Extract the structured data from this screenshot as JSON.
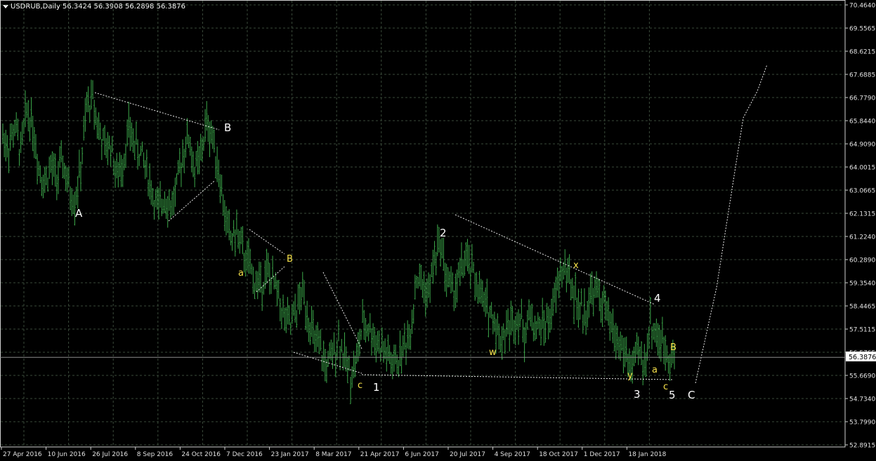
{
  "window": {
    "symbol_header": "USDRUB,Daily",
    "ohlc_header": "56.3424 56.3908 56.2898 56.3876",
    "current_price_label": "56.3876"
  },
  "colors": {
    "background": "#000000",
    "grid": "#3a4a3a",
    "candle": "#3ca84a",
    "wave_white": "#ffffff",
    "wave_yellow": "#f5e04a",
    "price_line": "#8c8c8c"
  },
  "icons": {
    "header_toggle": "triangle-down-icon"
  },
  "chart_data": {
    "type": "line",
    "title": "USDRUB,Daily",
    "x_ticks": [
      "27 Apr 2016",
      "10 Jun 2016",
      "26 Jul 2016",
      "8 Sep 2016",
      "24 Oct 2016",
      "7 Dec 2016",
      "23 Jan 2017",
      "8 Mar 2017",
      "21 Apr 2017",
      "6 Jun 2017",
      "20 Jul 2017",
      "4 Sep 2017",
      "18 Oct 2017",
      "1 Dec 2017",
      "18 Jan 2018"
    ],
    "y_ticks": [
      "70.4640",
      "69.5565",
      "68.6215",
      "67.6885",
      "66.7790",
      "65.8440",
      "64.9090",
      "64.0015",
      "63.0665",
      "62.1315",
      "61.2240",
      "60.2890",
      "59.3540",
      "58.4465",
      "57.5115",
      "56.5765",
      "55.6690",
      "54.7340",
      "53.7990",
      "52.8915"
    ],
    "ylim": [
      52.8915,
      70.464
    ],
    "current_price": 56.3876,
    "series": [
      {
        "values": [
          [
            0,
            65.2
          ],
          [
            4,
            64.8
          ],
          [
            8,
            65.6
          ],
          [
            12,
            64.6
          ],
          [
            16,
            66.3
          ],
          [
            20,
            65.7
          ],
          [
            24,
            64.0
          ],
          [
            28,
            63.4
          ],
          [
            32,
            64.0
          ],
          [
            36,
            63.5
          ],
          [
            40,
            64.2
          ],
          [
            44,
            63.1
          ],
          [
            48,
            62.7
          ],
          [
            52,
            63.9
          ],
          [
            56,
            66.4
          ],
          [
            60,
            66.7
          ],
          [
            64,
            65.5
          ],
          [
            68,
            64.7
          ],
          [
            72,
            64.9
          ],
          [
            76,
            63.6
          ],
          [
            80,
            64.2
          ],
          [
            84,
            65.5
          ],
          [
            88,
            64.9
          ],
          [
            92,
            64.5
          ],
          [
            96,
            63.9
          ],
          [
            100,
            62.9
          ],
          [
            104,
            62.2
          ],
          [
            108,
            62.9
          ],
          [
            112,
            62.4
          ],
          [
            116,
            63.1
          ],
          [
            120,
            64.6
          ],
          [
            124,
            65.2
          ],
          [
            128,
            63.8
          ],
          [
            132,
            64.4
          ],
          [
            136,
            65.8
          ],
          [
            140,
            65.2
          ],
          [
            144,
            63.9
          ],
          [
            148,
            62.1
          ],
          [
            152,
            61.1
          ],
          [
            156,
            61.4
          ],
          [
            160,
            60.6
          ],
          [
            164,
            60.1
          ],
          [
            168,
            59.4
          ],
          [
            172,
            59.3
          ],
          [
            176,
            59.8
          ],
          [
            180,
            59.4
          ],
          [
            184,
            58.8
          ],
          [
            188,
            57.9
          ],
          [
            192,
            57.6
          ],
          [
            196,
            58.3
          ],
          [
            200,
            59.0
          ],
          [
            204,
            58.0
          ],
          [
            208,
            57.0
          ],
          [
            212,
            56.6
          ],
          [
            216,
            56.0
          ],
          [
            220,
            56.4
          ],
          [
            224,
            57.2
          ],
          [
            228,
            56.3
          ],
          [
            232,
            55.7
          ],
          [
            236,
            56.3
          ],
          [
            240,
            57.7
          ],
          [
            244,
            57.6
          ],
          [
            248,
            57.2
          ],
          [
            252,
            56.8
          ],
          [
            256,
            56.5
          ],
          [
            260,
            56.1
          ],
          [
            264,
            56.3
          ],
          [
            268,
            56.9
          ],
          [
            272,
            57.5
          ],
          [
            276,
            59.6
          ],
          [
            280,
            59.3
          ],
          [
            284,
            58.9
          ],
          [
            288,
            60.4
          ],
          [
            292,
            61.0
          ],
          [
            296,
            59.6
          ],
          [
            300,
            59.0
          ],
          [
            304,
            59.5
          ],
          [
            308,
            60.3
          ],
          [
            312,
            59.9
          ],
          [
            316,
            59.4
          ],
          [
            320,
            58.6
          ],
          [
            324,
            58.3
          ],
          [
            328,
            57.9
          ],
          [
            332,
            57.1
          ],
          [
            336,
            57.5
          ],
          [
            340,
            57.8
          ],
          [
            344,
            58.1
          ],
          [
            348,
            57.4
          ],
          [
            352,
            58.1
          ],
          [
            356,
            57.5
          ],
          [
            360,
            57.7
          ],
          [
            364,
            57.8
          ],
          [
            368,
            58.6
          ],
          [
            372,
            59.8
          ],
          [
            376,
            59.9
          ],
          [
            380,
            59.1
          ],
          [
            384,
            58.4
          ],
          [
            388,
            58.1
          ],
          [
            392,
            58.9
          ],
          [
            396,
            59.0
          ],
          [
            400,
            58.6
          ],
          [
            404,
            57.9
          ],
          [
            408,
            57.2
          ],
          [
            412,
            56.9
          ],
          [
            416,
            56.4
          ],
          [
            420,
            55.9
          ],
          [
            424,
            56.6
          ],
          [
            428,
            56.1
          ],
          [
            432,
            57.8
          ],
          [
            436,
            57.3
          ],
          [
            440,
            56.9
          ],
          [
            444,
            56.6
          ],
          [
            448,
            56.4
          ]
        ]
      }
    ],
    "annotations": {
      "white_labels": [
        "A",
        "B",
        "1",
        "2",
        "3",
        "4",
        "5",
        "C"
      ],
      "yellow_labels": [
        "a",
        "B",
        "c",
        "w",
        "x",
        "y",
        "a",
        "B",
        "c"
      ]
    },
    "grid": true
  }
}
